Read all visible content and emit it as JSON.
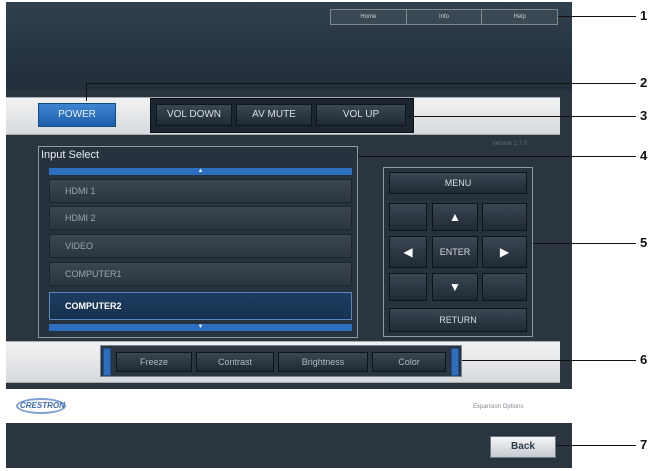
{
  "top_links": [
    "Home",
    "Info",
    "Help"
  ],
  "version": "Version 2.7.0",
  "power_label": "POWER",
  "av_controls": [
    "VOL DOWN",
    "AV MUTE",
    "VOL UP"
  ],
  "input_select": {
    "title": "Input Select",
    "items": [
      "HDMI 1",
      "HDMI 2",
      "VIDEO",
      "COMPUTER1",
      "COMPUTER2"
    ],
    "selected": "COMPUTER2"
  },
  "nav": {
    "menu": "MENU",
    "enter": "ENTER",
    "return": "RETURN"
  },
  "picture_controls": [
    "Freeze",
    "Contrast",
    "Brightness",
    "Color"
  ],
  "footer": {
    "logo": "CRESTRON",
    "expansion": "Expansion Options"
  },
  "back_label": "Back",
  "callouts": [
    "1",
    "2",
    "3",
    "4",
    "5",
    "6",
    "7"
  ]
}
